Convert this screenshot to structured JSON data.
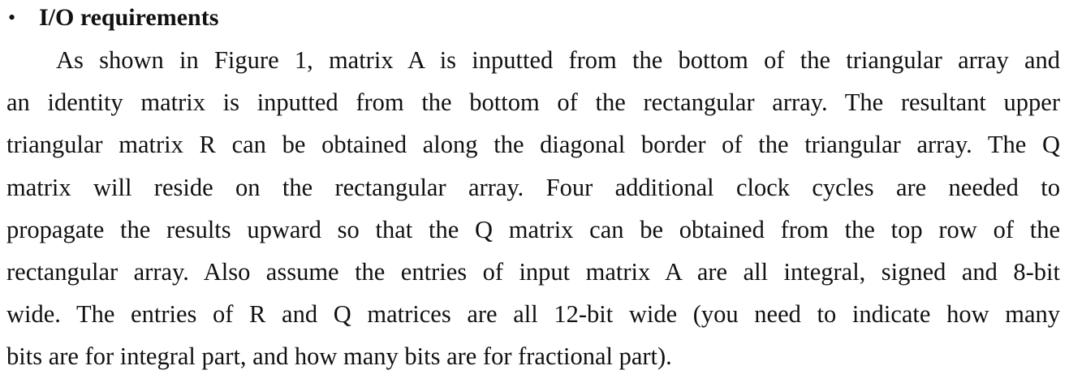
{
  "section": {
    "bullet": "•",
    "title": "I/O requirements"
  },
  "paragraph": {
    "lines": [
      "As shown in Figure 1, matrix A is inputted from the bottom of the triangular array and",
      "an identity matrix is inputted from the bottom of the rectangular array. The resultant upper",
      "triangular matrix R can be obtained along the diagonal border of the triangular array. The Q",
      "matrix will reside on the rectangular array. Four additional clock cycles are needed to",
      "propagate the results upward so that the Q matrix can be obtained from the top row of the",
      "rectangular array. Also assume the entries of input matrix A are all integral, signed and 8-bit",
      "wide. The entries of R and Q matrices are all 12-bit wide (you need to indicate how many",
      "bits are for integral part, and how many bits are for fractional part)."
    ]
  }
}
